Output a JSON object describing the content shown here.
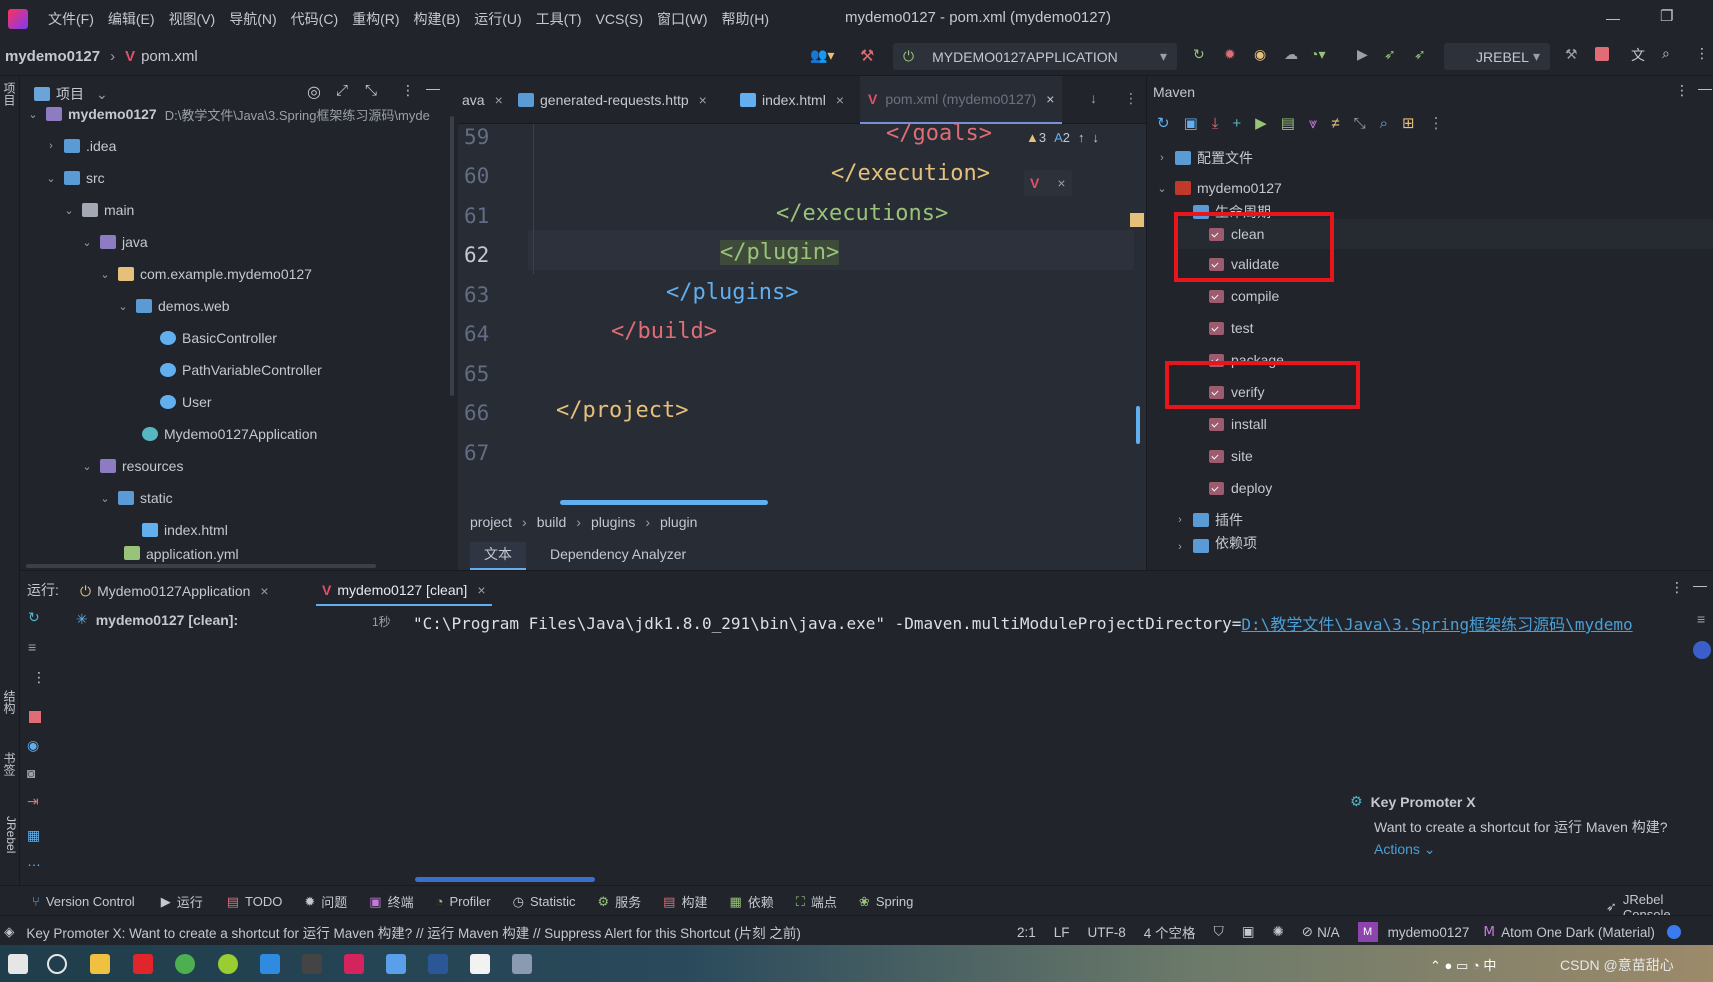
{
  "window": {
    "title": "mydemo0127 - pom.xml (mydemo0127)"
  },
  "menu": [
    "文件(F)",
    "编辑(E)",
    "视图(V)",
    "导航(N)",
    "代码(C)",
    "重构(R)",
    "构建(B)",
    "运行(U)",
    "工具(T)",
    "VCS(S)",
    "窗口(W)",
    "帮助(H)"
  ],
  "nav": {
    "project": "mydemo0127",
    "file": "pom.xml",
    "run_config": "MYDEMO0127APPLICATION",
    "jrebel": "JREBEL"
  },
  "project_panel": {
    "title": "项目",
    "items": [
      {
        "label": "mydemo0127",
        "path": "D:\\教学文件\\Java\\3.Spring框架练习源码\\myde"
      },
      {
        "label": ".idea"
      },
      {
        "label": "src"
      },
      {
        "label": "main"
      },
      {
        "label": "java"
      },
      {
        "label": "com.example.mydemo0127"
      },
      {
        "label": "demos.web"
      },
      {
        "label": "BasicController"
      },
      {
        "label": "PathVariableController"
      },
      {
        "label": "User"
      },
      {
        "label": "Mydemo0127Application"
      },
      {
        "label": "resources"
      },
      {
        "label": "static"
      },
      {
        "label": "index.html"
      },
      {
        "label": "application.yml"
      }
    ]
  },
  "editor": {
    "tabs": [
      "ava",
      "generated-requests.http",
      "index.html",
      "pom.xml (mydemo0127)"
    ],
    "line_numbers": [
      "59",
      "60",
      "61",
      "62",
      "63",
      "64",
      "65",
      "66",
      "67"
    ],
    "lines": [
      "</goals>",
      "</execution>",
      "</executions>",
      "</plugin>",
      "</plugins>",
      "</build>",
      "",
      "</project>",
      ""
    ],
    "warnings": "3",
    "weak": "2",
    "breadcrumb": [
      "project",
      "build",
      "plugins",
      "plugin"
    ],
    "bottom_tabs": [
      "文本",
      "Dependency Analyzer"
    ]
  },
  "maven": {
    "title": "Maven",
    "items": [
      "配置文件",
      "mydemo0127",
      "生命周期",
      "clean",
      "validate",
      "compile",
      "test",
      "package",
      "verify",
      "install",
      "site",
      "deploy",
      "插件",
      "依赖项"
    ]
  },
  "run": {
    "label": "运行:",
    "tabs": [
      "Mydemo0127Application",
      "mydemo0127 [clean]"
    ],
    "tree_item": "mydemo0127 [clean]:",
    "time": "1秒",
    "cmd": "\"C:\\Program Files\\Java\\jdk1.8.0_291\\bin\\java.exe\" -Dmaven.multiModuleProjectDirectory=",
    "cmd_link": "D:\\教学文件\\Java\\3.Spring框架练习源码\\mydemo"
  },
  "popup": {
    "title": "Key Promoter X",
    "text": "Want to create a shortcut for 运行 Maven 构建?",
    "actions": "Actions"
  },
  "side_labels": {
    "left_top": "项目",
    "left_b1": "结构",
    "left_b2": "书签",
    "left_b3": "JRebel"
  },
  "bottom_tools": [
    "Version Control",
    "运行",
    "TODO",
    "问题",
    "终端",
    "Profiler",
    "Statistic",
    "服务",
    "构建",
    "依赖",
    "端点",
    "Spring",
    "JRebel Console"
  ],
  "status": {
    "message": "Key Promoter X: Want to create a shortcut for 运行 Maven 构建? // 运行 Maven 构建 // Suppress Alert for this Shortcut (片刻 之前)",
    "pos": "2:1",
    "lf": "LF",
    "enc": "UTF-8",
    "indent": "4 个空格",
    "na": "N/A",
    "project": "mydemo0127",
    "theme": "Atom One Dark (Material)"
  },
  "taskbar": {
    "watermark": "CSDN @意苗甜心"
  }
}
